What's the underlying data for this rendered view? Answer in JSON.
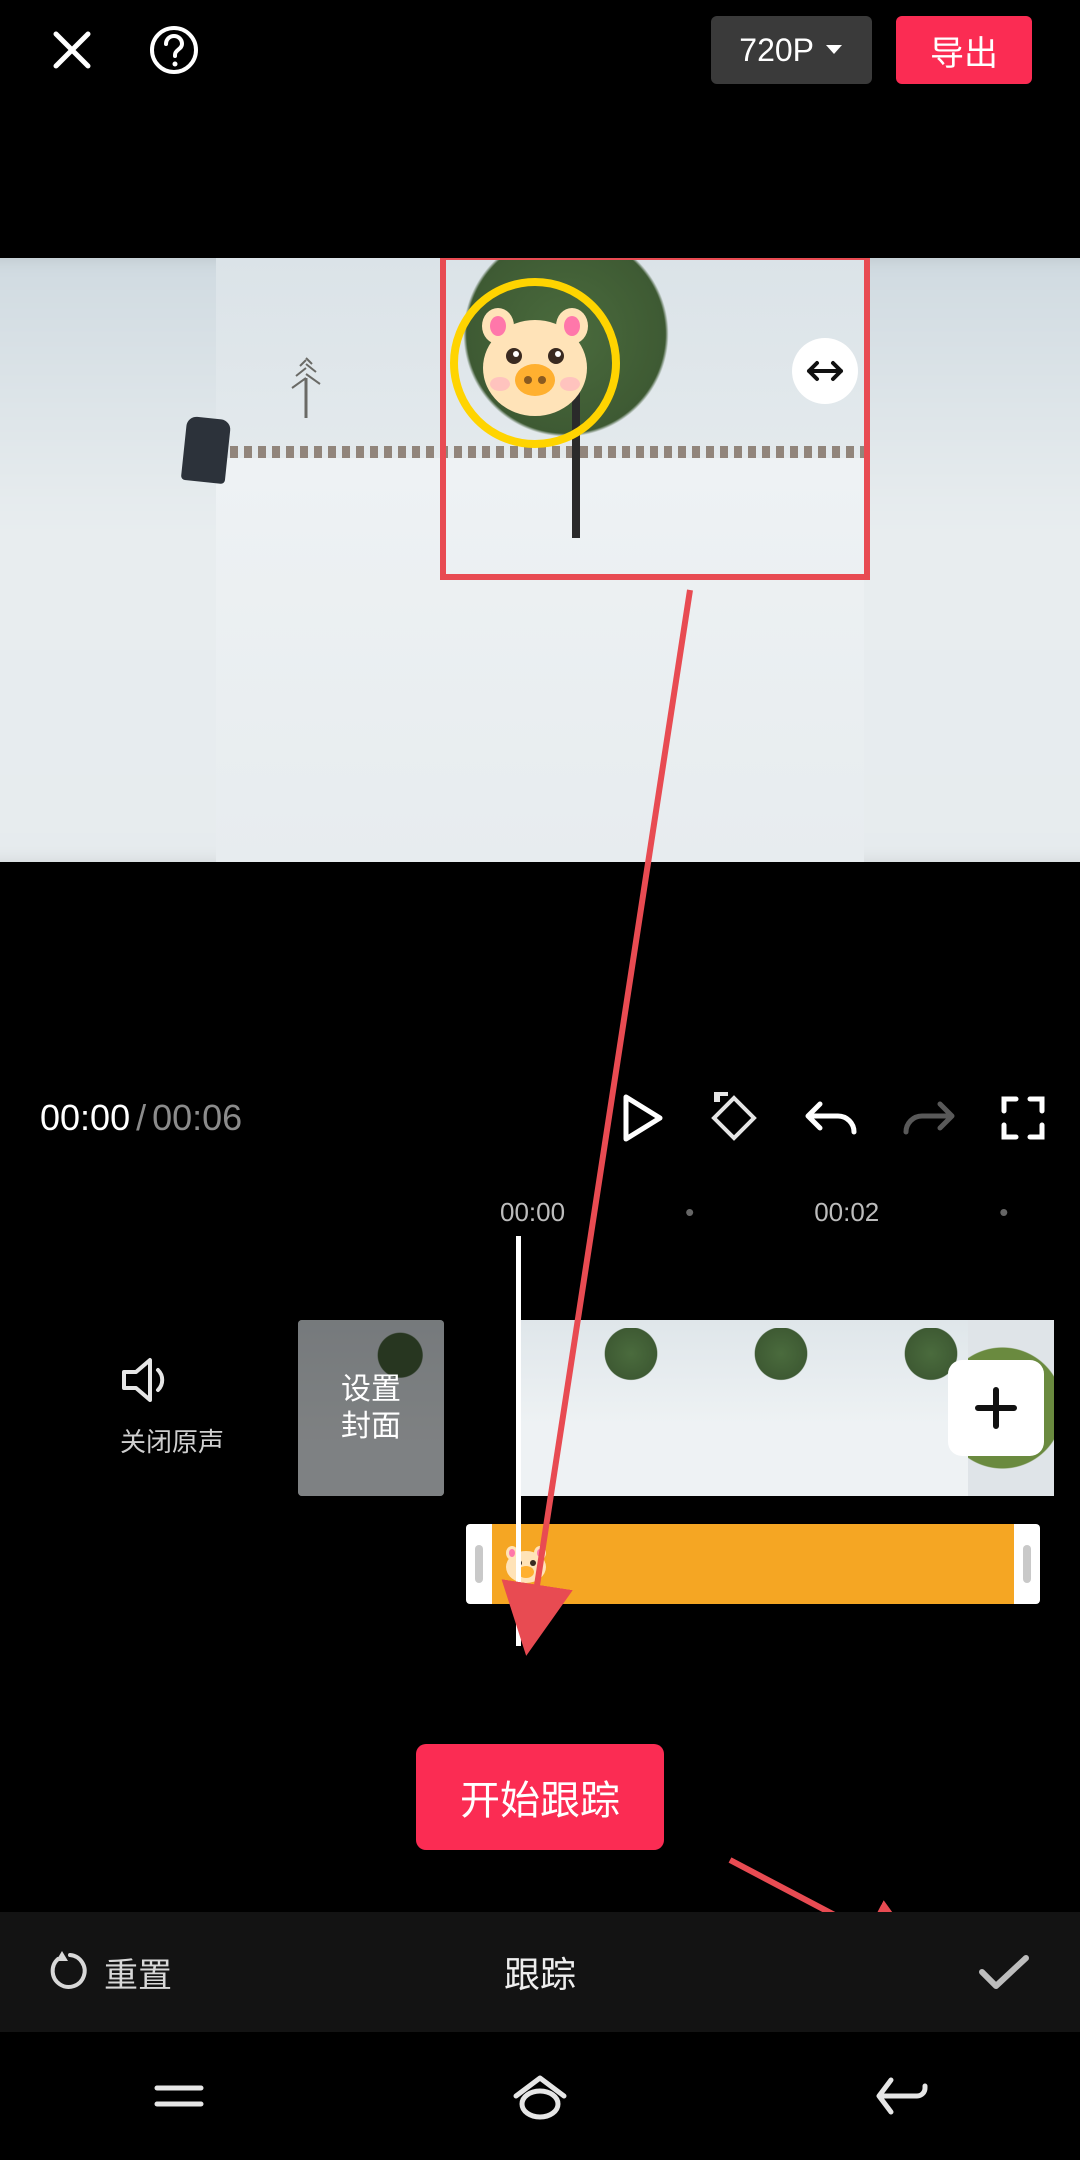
{
  "header": {
    "resolution_label": "720P",
    "export_label": "导出"
  },
  "preview": {
    "sticker_name": "pig-sticker"
  },
  "playback": {
    "current_time": "00:00",
    "total_time": "00:06"
  },
  "ruler": {
    "t0": "00:00",
    "t1": "00:02"
  },
  "tracks": {
    "mute_label": "关闭原声",
    "cover_label": "设置\n封面"
  },
  "action": {
    "start_tracking_label": "开始跟踪"
  },
  "panel": {
    "reset_label": "重置",
    "title": "跟踪"
  }
}
